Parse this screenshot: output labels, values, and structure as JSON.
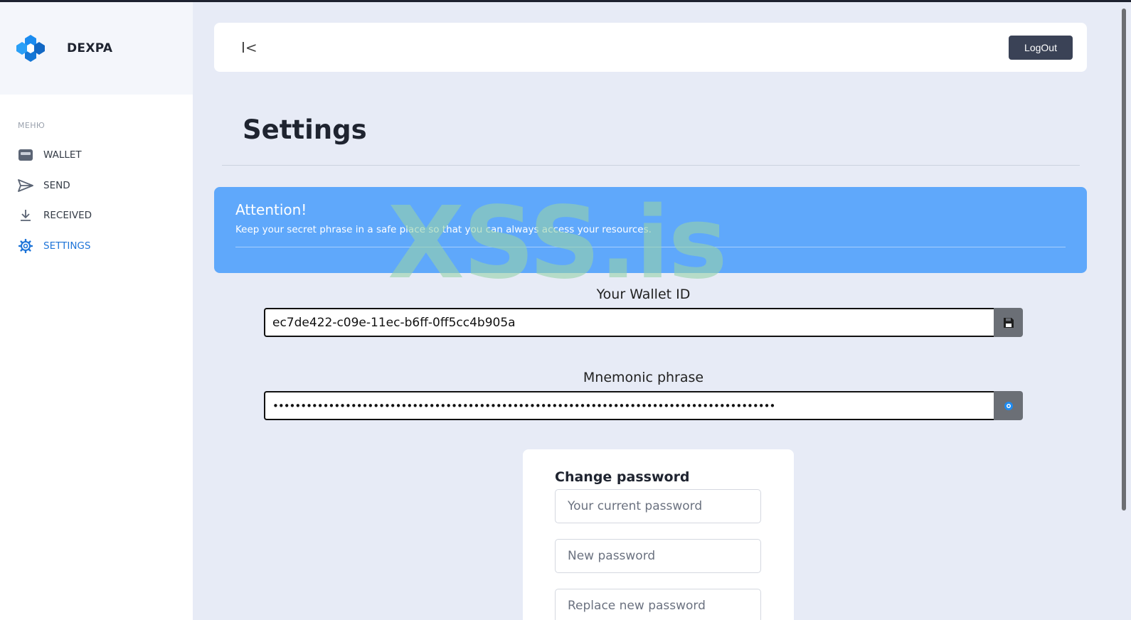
{
  "brand": {
    "name": "DEXPA"
  },
  "sidebar": {
    "caption": "МЕНЮ",
    "items": [
      {
        "label": "WALLET",
        "icon": "wallet-icon",
        "active": false
      },
      {
        "label": "SEND",
        "icon": "send-icon",
        "active": false
      },
      {
        "label": "RECEIVED",
        "icon": "download-icon",
        "active": false
      },
      {
        "label": "SETTINGS",
        "icon": "gear-icon",
        "active": true
      }
    ]
  },
  "header": {
    "collapse_label": "I<",
    "logout_label": "LogOut"
  },
  "page": {
    "title": "Settings"
  },
  "alert": {
    "title": "Attention!",
    "text": "Keep your secret phrase in a safe place so that you can always access your resources."
  },
  "watermark": "XSS.is",
  "wallet": {
    "id_label": "Your Wallet ID",
    "id_value": "ec7de422-c09e-11ec-b6ff-0ff5cc4b905a",
    "mnemonic_label": "Mnemonic phrase",
    "mnemonic_masked": "••••••••••••••••••••••••••••••••••••••••••••••••••••••••••••••••••••••••••••••••••••••••••"
  },
  "change_password": {
    "title": "Change password",
    "current_placeholder": "Your current password",
    "new_placeholder": "New password",
    "repeat_placeholder": "Replace new password"
  },
  "colors": {
    "accent": "#1d74d8",
    "alert_bg": "#5fa8fb",
    "logout_bg": "#3a4256",
    "page_bg": "#e7ebf6"
  }
}
